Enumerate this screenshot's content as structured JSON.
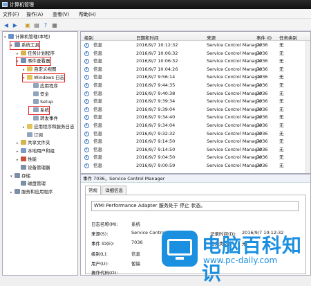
{
  "window": {
    "title": "计算机管理"
  },
  "menu": [
    "文件(F)",
    "操作(A)",
    "查看(V)",
    "帮助(H)"
  ],
  "tree": [
    {
      "label": "计算机管理(本地)",
      "indent": 0,
      "exp": "▾",
      "color": "#6b8ec8"
    },
    {
      "label": "系统工具",
      "indent": 1,
      "exp": "▾",
      "color": "#7c8fa8",
      "hl": true
    },
    {
      "label": "任务计划程序",
      "indent": 2,
      "exp": "▸",
      "color": "#d6b24a"
    },
    {
      "label": "事件查看器",
      "indent": 2,
      "exp": "▾",
      "color": "#6f8fb8",
      "hl": true
    },
    {
      "label": "自定义视图",
      "indent": 3,
      "exp": "▸",
      "color": "#e2c35a"
    },
    {
      "label": "Windows 日志",
      "indent": 3,
      "exp": "▾",
      "color": "#e2c35a",
      "hl": true
    },
    {
      "label": "应用程序",
      "indent": 4,
      "exp": "",
      "color": "#8fa4bd"
    },
    {
      "label": "安全",
      "indent": 4,
      "exp": "",
      "color": "#8fa4bd"
    },
    {
      "label": "Setup",
      "indent": 4,
      "exp": "",
      "color": "#8fa4bd"
    },
    {
      "label": "系统",
      "indent": 4,
      "exp": "",
      "color": "#8fa4bd",
      "hl": true
    },
    {
      "label": "转发事件",
      "indent": 4,
      "exp": "",
      "color": "#8fa4bd"
    },
    {
      "label": "应用程序和服务日志",
      "indent": 3,
      "exp": "▸",
      "color": "#e2c35a"
    },
    {
      "label": "订阅",
      "indent": 3,
      "exp": "",
      "color": "#8fa4bd"
    },
    {
      "label": "共享文件夹",
      "indent": 2,
      "exp": "▸",
      "color": "#d6b24a"
    },
    {
      "label": "本地用户和组",
      "indent": 2,
      "exp": "▸",
      "color": "#7c9bc4"
    },
    {
      "label": "性能",
      "indent": 2,
      "exp": "▸",
      "color": "#c8503c"
    },
    {
      "label": "设备管理器",
      "indent": 2,
      "exp": "",
      "color": "#7c8fa8"
    },
    {
      "label": "存储",
      "indent": 1,
      "exp": "▾",
      "color": "#7c8fa8"
    },
    {
      "label": "磁盘管理",
      "indent": 2,
      "exp": "",
      "color": "#7c8fa8"
    },
    {
      "label": "服务和应用程序",
      "indent": 1,
      "exp": "▸",
      "color": "#7c8fa8"
    }
  ],
  "columns": [
    "级别",
    "日期和时间",
    "来源",
    "事件 ID",
    "任务类别"
  ],
  "events": [
    [
      "信息",
      "2016/9/7 10:12:32",
      "Service Control Manager",
      "7036",
      "无"
    ],
    [
      "信息",
      "2016/9/7 10:06:32",
      "Service Control Manager",
      "7036",
      "无"
    ],
    [
      "信息",
      "2016/9/7 10:06:32",
      "Service Control Manager",
      "7036",
      "无"
    ],
    [
      "信息",
      "2016/9/7 10:04:26",
      "Service Control Manager",
      "7036",
      "无"
    ],
    [
      "信息",
      "2016/9/7 9:56:14",
      "Service Control Manager",
      "7036",
      "无"
    ],
    [
      "信息",
      "2016/9/7 9:44:35",
      "Service Control Manager",
      "7036",
      "无"
    ],
    [
      "信息",
      "2016/9/7 9:40:38",
      "Service Control Manager",
      "7036",
      "无"
    ],
    [
      "信息",
      "2016/9/7 9:39:34",
      "Service Control Manager",
      "7036",
      "无"
    ],
    [
      "信息",
      "2016/9/7 9:39:04",
      "Service Control Manager",
      "7036",
      "无"
    ],
    [
      "信息",
      "2016/9/7 9:34:40",
      "Service Control Manager",
      "7036",
      "无"
    ],
    [
      "信息",
      "2016/9/7 9:34:04",
      "Service Control Manager",
      "7036",
      "无"
    ],
    [
      "信息",
      "2016/9/7 9:32:32",
      "Service Control Manager",
      "7036",
      "无"
    ],
    [
      "信息",
      "2016/9/7 9:14:50",
      "Service Control Manager",
      "7036",
      "无"
    ],
    [
      "信息",
      "2016/9/7 9:14:50",
      "Service Control Manager",
      "7036",
      "无"
    ],
    [
      "信息",
      "2016/9/7 9:04:50",
      "Service Control Manager",
      "7036",
      "无"
    ],
    [
      "信息",
      "2016/9/7 9:00:59",
      "Service Control Manager",
      "7036",
      "无"
    ]
  ],
  "detail": {
    "header": "事件 7036，Service Control Manager",
    "tabs": [
      "常规",
      "详细信息"
    ],
    "message": "WMI Performance Adapter 服务处于 停止 状态。",
    "log_name_label": "日志名称(M):",
    "log_name": "系统",
    "source_label": "来源(S):",
    "source": "Service Control Manager",
    "recorded_label": "记录时间(D):",
    "recorded": "2016/9/7 10:12:32",
    "event_id_label": "事件 ID(E):",
    "event_id": "7036",
    "task_label": "任务类别(Y):",
    "task": "无",
    "level_label": "级别(L):",
    "level": "信息",
    "user_label": "用户(U):",
    "user": "暂缺",
    "opcode_label": "操作代码(O):"
  },
  "watermark": {
    "brand": "电脑百科知识",
    "url": "www.pc-daily.com"
  }
}
